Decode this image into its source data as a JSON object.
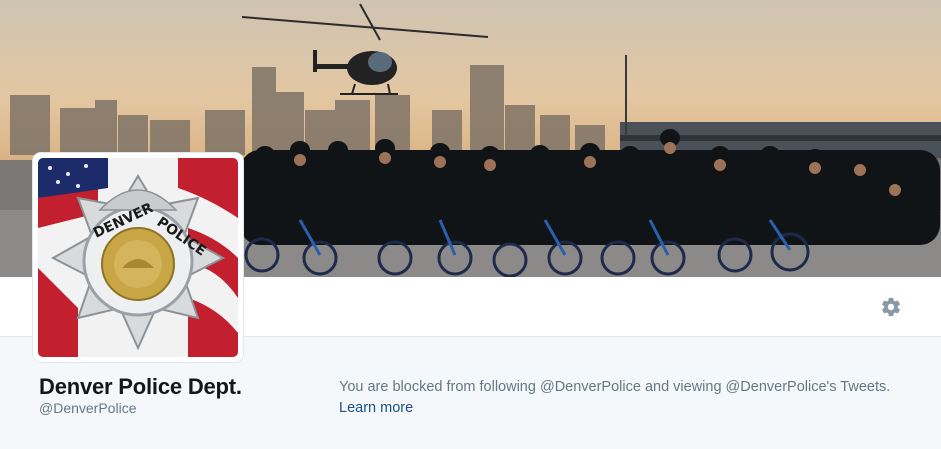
{
  "profile": {
    "name": "Denver Police Dept.",
    "handle": "@DenverPolice",
    "blocked_message": "You are blocked from following @DenverPolice and viewing @DenverPolice's Tweets.",
    "learn_more": "Learn more"
  },
  "header": {
    "settings_icon": "gear-icon",
    "banner": "photo of police bicycle unit with helicopter and city skyline"
  },
  "avatar": {
    "badge_text_top": "DENVER",
    "badge_text_bottom": "POLICE"
  },
  "colors": {
    "background": "#f5f8fa",
    "name_text": "#14171a",
    "muted_text": "#657786",
    "link": "#1b4f8a",
    "gear": "#8899a6"
  }
}
